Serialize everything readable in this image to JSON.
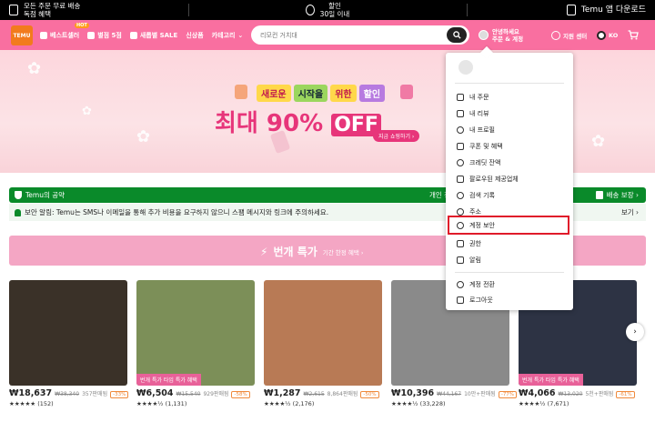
{
  "topbar": {
    "free_shipping_line1": "모든 주문 무료 배송",
    "free_shipping_line2": "독점 혜택",
    "returns_line1": "할인",
    "returns_line2": "30일 이내",
    "app_download": "Temu 앱 다운로드"
  },
  "header": {
    "logo_text": "TEMU",
    "nav": [
      {
        "label": "베스트셀러",
        "badge": "HOT",
        "icon": "thumbs-up-icon"
      },
      {
        "label": "별점 5점",
        "icon": "star-icon"
      },
      {
        "label": "새롭별 SALE",
        "icon": "new-icon"
      },
      {
        "label": "신상품"
      },
      {
        "label": "카테고리"
      }
    ],
    "search_placeholder": "리모컨 거치대",
    "account_line1": "안녕하세요",
    "account_line2": "주문 & 계정",
    "help_label": "지원 센터",
    "lang_label": "KO"
  },
  "banner": {
    "pills": [
      "새로운",
      "시작을",
      "위한",
      "할인"
    ],
    "sale_text": "최대 90%",
    "off_text": "OFF",
    "shop_now": "지금 쇼핑하기 ›"
  },
  "promise": {
    "left": "Temu의 공약",
    "middle": "개인 정",
    "right": "배송 보장 ›"
  },
  "notice": {
    "text": "보안 알림: Temu는 SMS나 이메일을 통해 추가 비용을 요구하지 않으니 스팸 메시지와 링크에 주의하세요.",
    "more": "보기 ›"
  },
  "deals": {
    "title": "번개 특가",
    "subtitle": "기간 한정 혜택 ›"
  },
  "products": [
    {
      "price": "₩18,637",
      "orig": "₩38,340",
      "sold": "357판매됨",
      "disc": "-33%",
      "stars": "★★★★★ (152)",
      "tag": "",
      "color": "#3a3128"
    },
    {
      "price": "₩6,504",
      "orig": "₩15,540",
      "sold": "929판매됨",
      "disc": "-58%",
      "stars": "★★★★½ (1,131)",
      "tag": "번개 특가   타임 특가 혜택",
      "color": "#7c8f58"
    },
    {
      "price": "₩1,287",
      "orig": "₩2,615",
      "sold": "8,864판매됨",
      "disc": "-50%",
      "stars": "★★★★½ (2,176)",
      "tag": "",
      "color": "#b87a55"
    },
    {
      "price": "₩10,396",
      "orig": "₩44,167",
      "sold": "10만+판매됨",
      "disc": "-77%",
      "stars": "★★★★½ (33,228)",
      "tag": "",
      "color": "#8a8a8a"
    },
    {
      "price": "₩4,066",
      "orig": "₩13,020",
      "sold": "5천+판매됨",
      "disc": "-61%",
      "stars": "★★★★½ (7,671)",
      "tag": "번개 특가   타임 특가 혜택",
      "color": "#2d3344"
    }
  ],
  "dropdown": {
    "items": [
      {
        "label": "내 주문",
        "icon": "order-icon"
      },
      {
        "label": "내 리뷰",
        "icon": "review-icon"
      },
      {
        "label": "내 프로필",
        "icon": "profile-icon"
      },
      {
        "label": "쿠폰 및 혜택",
        "icon": "coupon-icon"
      },
      {
        "label": "크레딧 잔액",
        "icon": "credit-icon"
      },
      {
        "label": "팔로우된 제공업체",
        "icon": "store-icon"
      },
      {
        "label": "검색 기록",
        "icon": "history-icon"
      },
      {
        "label": "주소",
        "icon": "location-icon"
      },
      {
        "label": "계정 보안",
        "icon": "security-icon"
      },
      {
        "label": "권한",
        "icon": "permission-icon"
      },
      {
        "label": "알림",
        "icon": "bell-icon"
      },
      {
        "label": "계정 전환",
        "icon": "switch-account-icon"
      },
      {
        "label": "로그아웃",
        "icon": "logout-icon"
      }
    ]
  },
  "colors": {
    "header": "#f96fa0",
    "promise": "#0a8a2a",
    "highlight": "#e01a2a"
  }
}
